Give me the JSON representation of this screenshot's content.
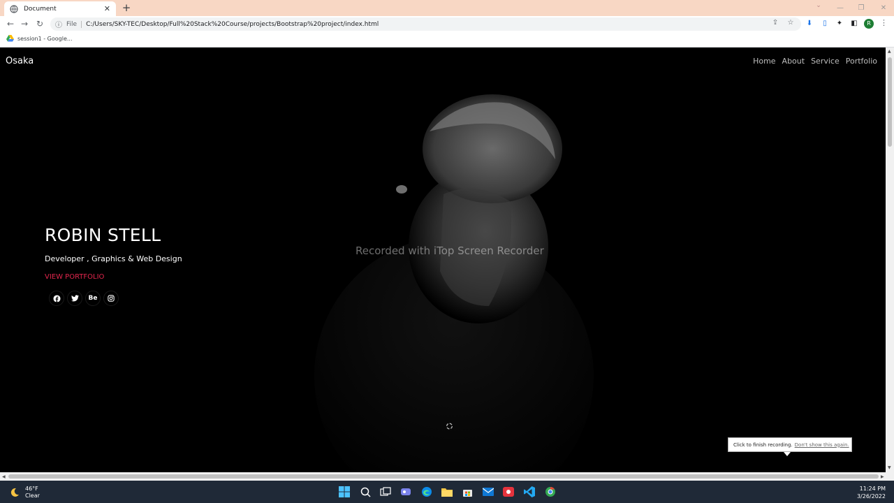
{
  "browser": {
    "tab_title": "Document",
    "address_scheme": "File",
    "address_url": "C:/Users/SKY-TEC/Desktop/Full%20Stack%20Course/projects/Bootstrap%20project/index.html",
    "bookmark_label": "session1 - Google...",
    "profile_initial": "R"
  },
  "page": {
    "brand": "Osaka",
    "nav": [
      "Home",
      "About",
      "Service",
      "Portfolio"
    ],
    "hero_name": "ROBIN STELL",
    "hero_subtitle": "Developer , Graphics & Web Design",
    "hero_link": "VIEW PORTFOLIO",
    "social_behance": "Be",
    "accent_color": "#e2264d"
  },
  "overlay": {
    "watermark": "Recorded with iTop Screen Recorder",
    "callout_text": "Click to finish recording.",
    "callout_link": "Don't show this again."
  },
  "taskbar": {
    "temperature": "46°F",
    "condition": "Clear",
    "time": "11:24 PM",
    "date": "3/26/2022"
  }
}
